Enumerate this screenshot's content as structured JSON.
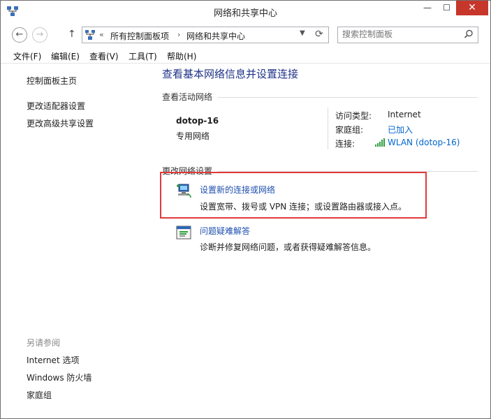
{
  "window": {
    "title": "网络和共享中心"
  },
  "controls": {
    "minimize": "—",
    "maximize": "☐",
    "close": "✕"
  },
  "nav": {
    "back": "←",
    "forward": "→",
    "up": "↑",
    "breadcrumb": [
      "所有控制面板项",
      "网络和共享中心"
    ],
    "breadcrumb_prefix": "«",
    "separator": "›",
    "search_placeholder": "搜索控制面板"
  },
  "menu": [
    "文件(F)",
    "编辑(E)",
    "查看(V)",
    "工具(T)",
    "帮助(H)"
  ],
  "sidebar": {
    "top_links": [
      "控制面板主页",
      "更改适配器设置",
      "更改高级共享设置"
    ],
    "see_also_heading": "另请参阅",
    "see_also_links": [
      "Internet 选项",
      "Windows 防火墙",
      "家庭组"
    ]
  },
  "main": {
    "title": "查看基本网络信息并设置连接",
    "active_networks_label": "查看活动网络",
    "network": {
      "name": "dotop-16",
      "type": "专用网络",
      "access_type_label": "访问类型:",
      "access_type_value": "Internet",
      "homegroup_label": "家庭组:",
      "homegroup_value": "已加入",
      "connection_label": "连接:",
      "connection_value": "WLAN (dotop-16)"
    },
    "change_settings_label": "更改网络设置",
    "tasks": [
      {
        "title": "设置新的连接或网络",
        "description": "设置宽带、拨号或 VPN 连接；或设置路由器或接入点。"
      },
      {
        "title": "问题疑难解答",
        "description": "诊断并修复网络问题，或者获得疑难解答信息。"
      }
    ]
  },
  "colors": {
    "link": "#0066cc",
    "title": "#1e3287",
    "highlight": "#e03a3a",
    "close": "#c7362b"
  }
}
